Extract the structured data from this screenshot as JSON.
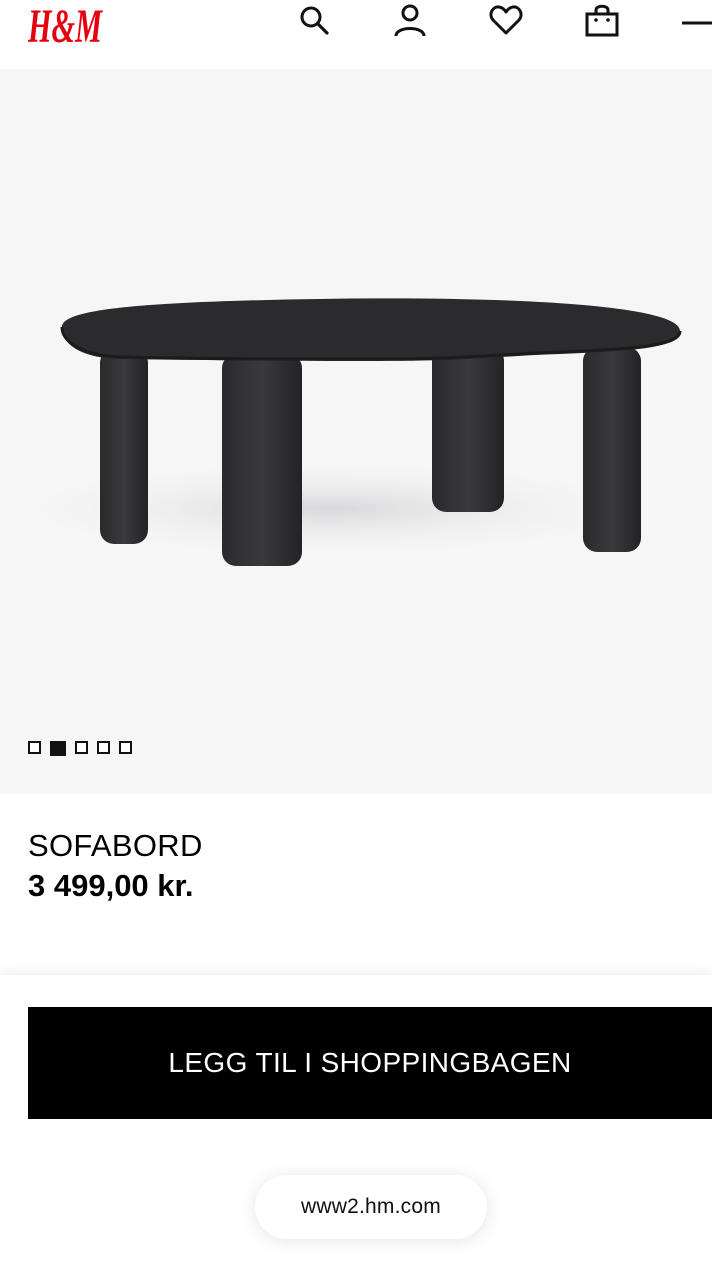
{
  "header": {
    "logo_text": "H&M",
    "brand_color": "#e50010",
    "icons": [
      "search-icon",
      "account-icon",
      "heart-icon",
      "shopping-bag-icon",
      "menu-icon"
    ]
  },
  "gallery": {
    "image_count": 5,
    "active_index": 1,
    "background": "#f6f6f7"
  },
  "product": {
    "name": "SOFABORD",
    "price": "3 499,00 kr."
  },
  "actions": {
    "add_to_bag_label": "LEGG TIL I SHOPPINGBAGEN"
  },
  "browser": {
    "url": "www2.hm.com"
  }
}
